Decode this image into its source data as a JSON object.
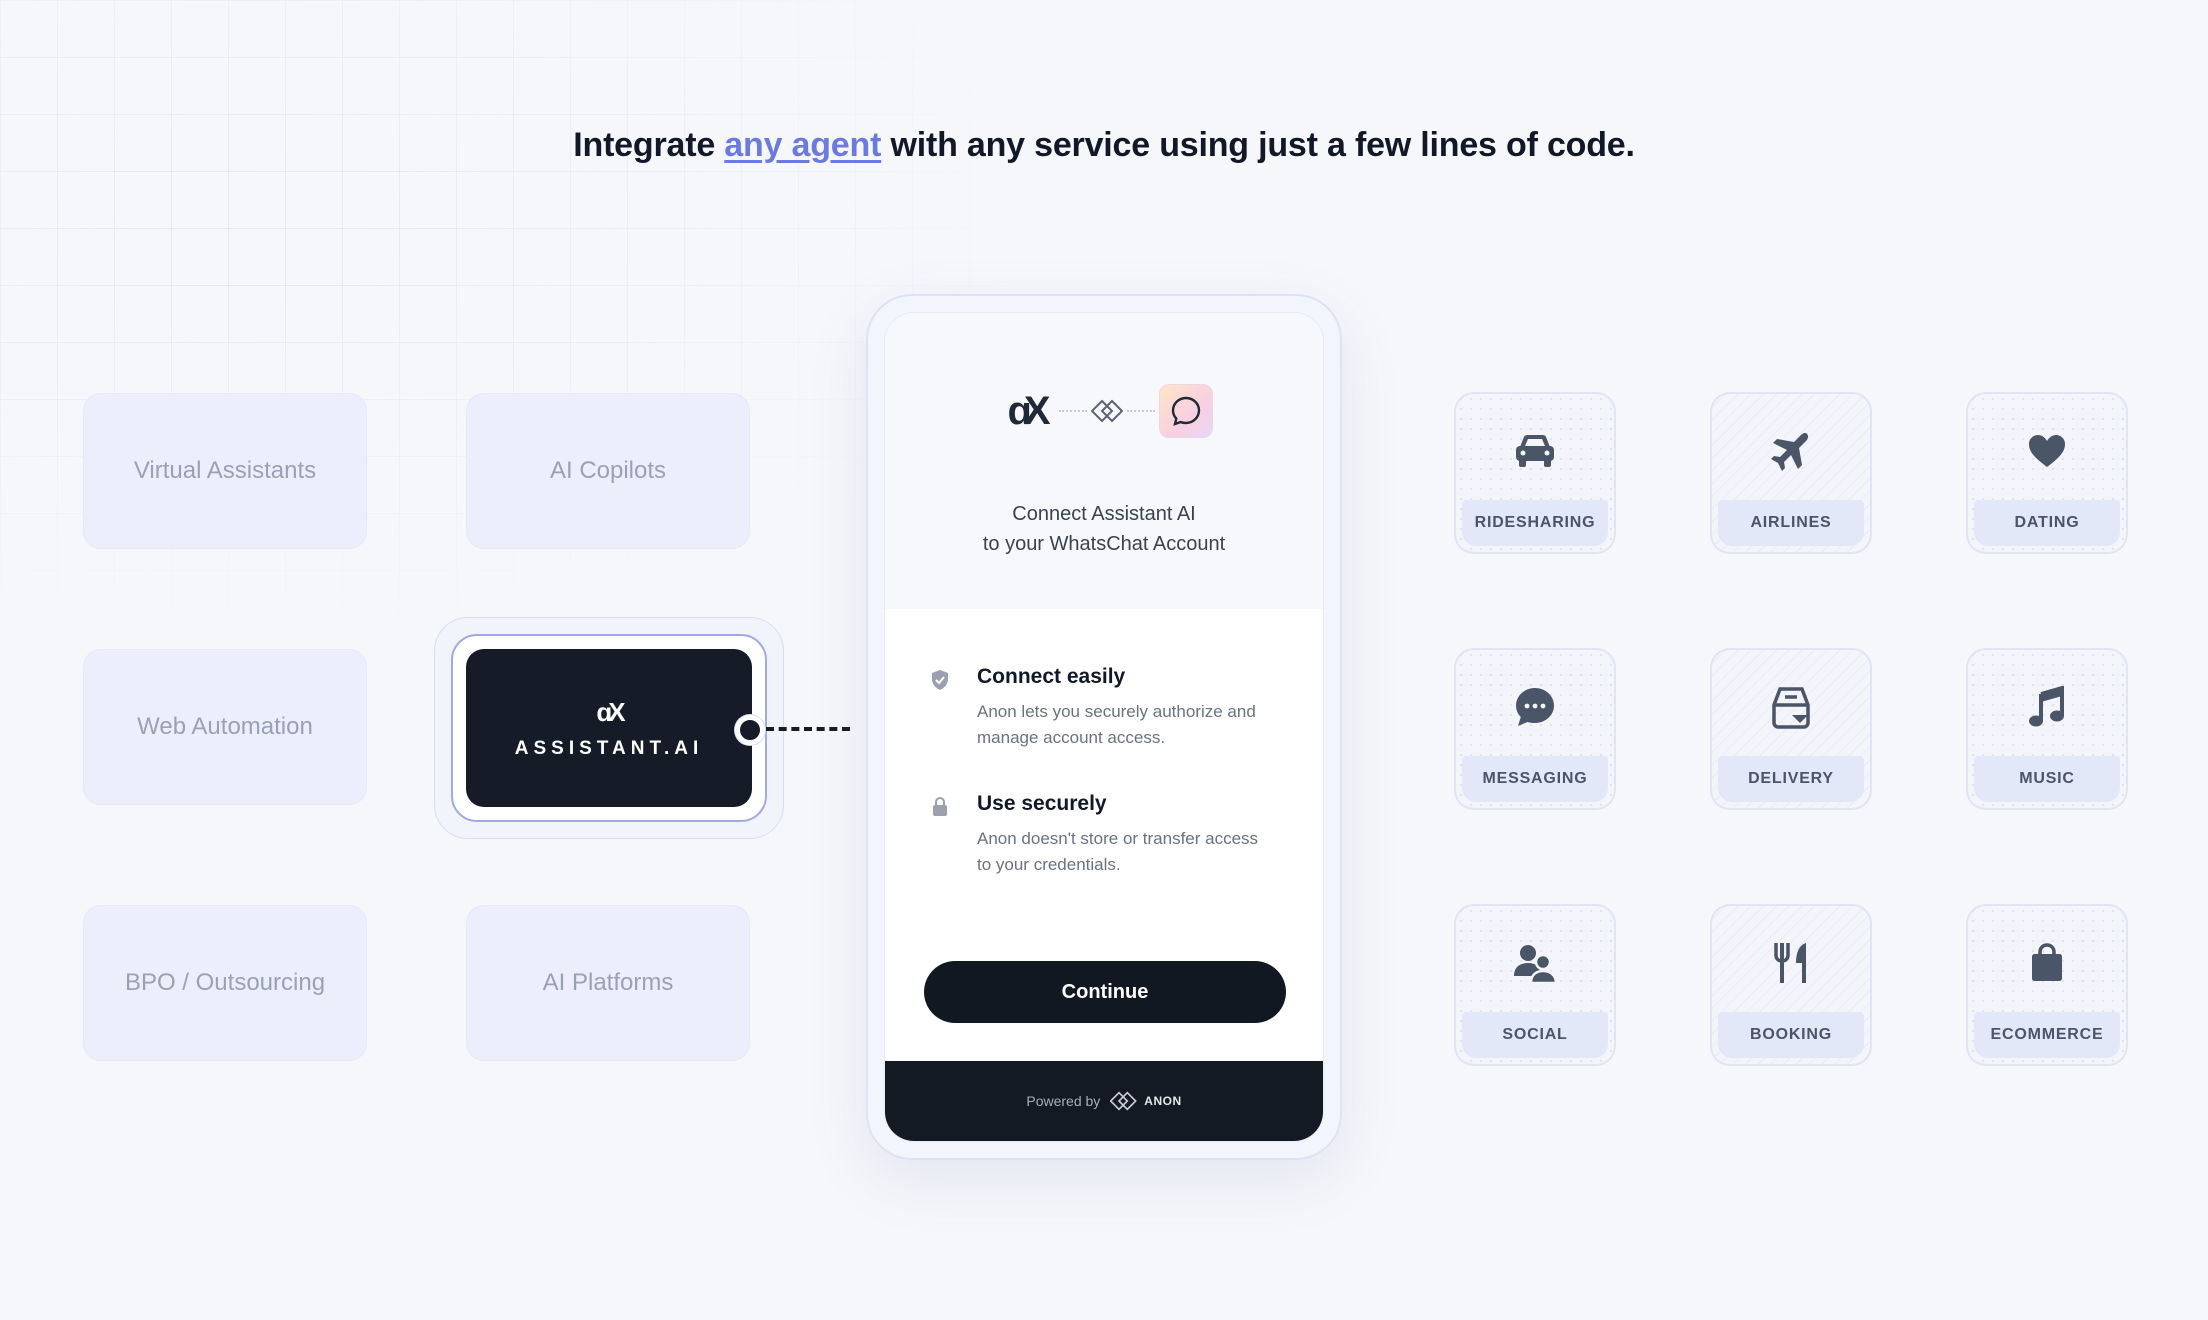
{
  "headline": {
    "before": "Integrate ",
    "link": "any agent",
    "after": " with any service using just a few lines of code."
  },
  "agent_tiles": [
    "Virtual Assistants",
    "AI Copilots",
    "Web Automation",
    "BPO / Outsourcing",
    "AI Platforms"
  ],
  "assistant": {
    "logo": "ɑX",
    "name": "ASSISTANT.AI"
  },
  "phone": {
    "connect_line1": "Connect Assistant AI",
    "connect_line2": "to your WhatsChat Account",
    "features": [
      {
        "icon": "shield-check-icon",
        "title": "Connect easily",
        "desc": "Anon lets you securely authorize and manage account access."
      },
      {
        "icon": "lock-icon",
        "title": "Use securely",
        "desc": "Anon doesn't store or transfer access to your credentials."
      }
    ],
    "continue_label": "Continue",
    "powered_by": "Powered by",
    "brand": "ANON"
  },
  "services": [
    {
      "label": "RIDESHARING",
      "icon": "car-icon"
    },
    {
      "label": "AIRLINES",
      "icon": "airplane-icon"
    },
    {
      "label": "DATING",
      "icon": "heart-icon"
    },
    {
      "label": "MESSAGING",
      "icon": "chat-bubble-icon"
    },
    {
      "label": "DELIVERY",
      "icon": "delivery-bag-icon"
    },
    {
      "label": "MUSIC",
      "icon": "music-note-icon"
    },
    {
      "label": "SOCIAL",
      "icon": "users-icon"
    },
    {
      "label": "BOOKING",
      "icon": "fork-knife-icon"
    },
    {
      "label": "ECOMMERCE",
      "icon": "shopping-bag-icon"
    }
  ],
  "colors": {
    "accent": "#6b7ae0",
    "dark": "#141a24",
    "icon": "#4b5568"
  }
}
